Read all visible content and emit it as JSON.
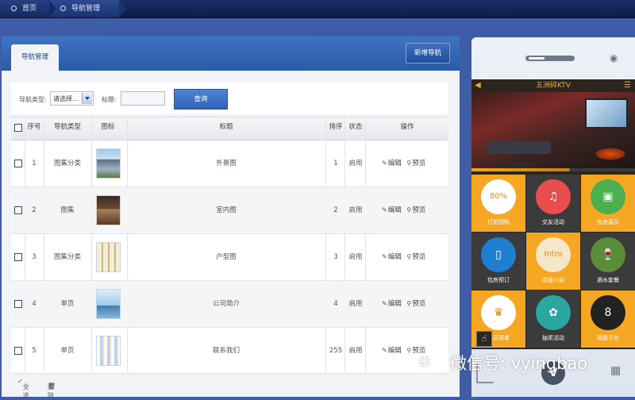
{
  "breadcrumb": {
    "home": "首页",
    "current": "导航管理"
  },
  "panel": {
    "tab": "导航管理",
    "add_button": "新增导航"
  },
  "filter": {
    "type_label": "导航类型:",
    "type_select": "请选择...",
    "title_label": "标题:",
    "title_value": "",
    "query_button": "查询"
  },
  "table": {
    "columns": [
      "序号",
      "导航类型",
      "图标",
      "标题",
      "排序",
      "状态",
      "操作"
    ],
    "rows": [
      {
        "index": "1",
        "type": "图集分类",
        "title": "外景图",
        "order": "1",
        "status": "启用"
      },
      {
        "index": "2",
        "type": "图集",
        "title": "室内图",
        "order": "2",
        "status": "启用"
      },
      {
        "index": "3",
        "type": "图集分类",
        "title": "户型图",
        "order": "3",
        "status": "启用"
      },
      {
        "index": "4",
        "type": "单页",
        "title": "公司简介",
        "order": "4",
        "status": "启用"
      },
      {
        "index": "5",
        "type": "单页",
        "title": "联系我们",
        "order": "255",
        "status": "启用"
      }
    ],
    "edit_label": "编辑",
    "preview_label": "预览"
  },
  "footer": {
    "select_all": "全选",
    "delete": "删除"
  },
  "phone": {
    "app_title": "五洲碎KTV",
    "grid": [
      {
        "label": "打折团购",
        "icon": "discount-icon",
        "tile": "#f5a623",
        "circle": "#ffffff",
        "glyph": "80%"
      },
      {
        "label": "交友活动",
        "icon": "headphones-icon",
        "tile": "#3b3b3b",
        "circle": "#e94e4e",
        "glyph": "♫"
      },
      {
        "label": "包房展示",
        "icon": "picture-icon",
        "tile": "#f5a623",
        "circle": "#4caf50",
        "glyph": "▣"
      },
      {
        "label": "包房预订",
        "icon": "phone-booking-icon",
        "tile": "#3b3b3b",
        "circle": "#1e7fd0",
        "glyph": "▯"
      },
      {
        "label": "店面介绍",
        "icon": "introduction-icon",
        "tile": "#f5a623",
        "circle": "#f6e7c8",
        "glyph": "Intro"
      },
      {
        "label": "酒水套餐",
        "icon": "wine-icon",
        "tile": "#3b3b3b",
        "circle": "#5b8c3a",
        "glyph": "🍷"
      },
      {
        "label": "会员预单",
        "icon": "crown-icon",
        "tile": "#f5a623",
        "circle": "#ffffff",
        "glyph": "♛"
      },
      {
        "label": "抽奖活动",
        "icon": "lottery-wheel-icon",
        "tile": "#3b3b3b",
        "circle": "#2aa7a0",
        "glyph": "✿"
      },
      {
        "label": "摇骰子比",
        "icon": "billiards-icon",
        "tile": "#f5a623",
        "circle": "#222222",
        "glyph": "8"
      }
    ]
  },
  "watermark": {
    "text": "微信号: vyingbao"
  }
}
